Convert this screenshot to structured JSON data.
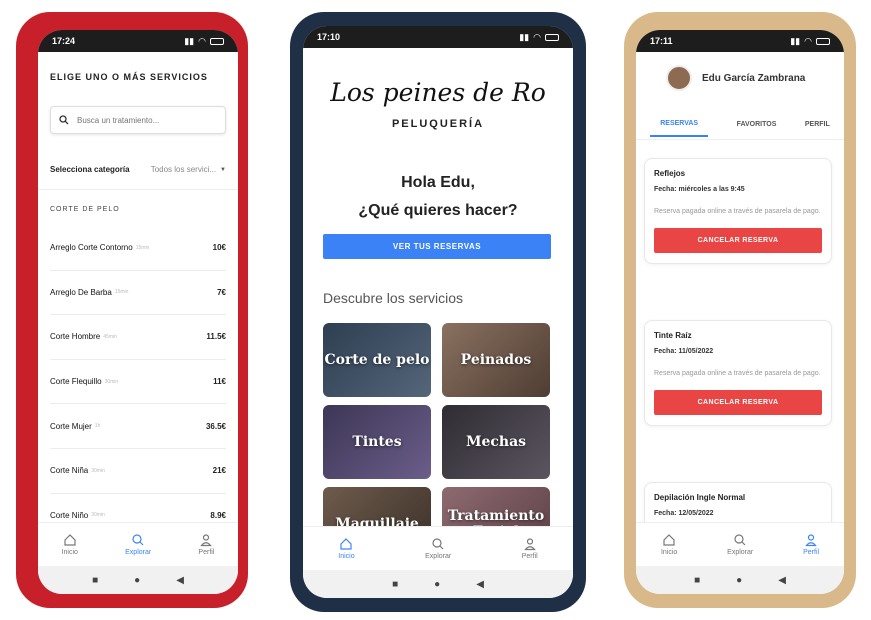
{
  "phone1": {
    "time": "17:24",
    "title": "ELIGE UNO O MÁS SERVICIOS",
    "search_placeholder": "Busca un tratamiento...",
    "category_label": "Selecciona categoría",
    "category_value": "Todos los servici...",
    "group": "CORTE DE PELO",
    "services": [
      {
        "name": "Arreglo Corte Contorno",
        "duration": "15min",
        "price": "10€"
      },
      {
        "name": "Arreglo De Barba",
        "duration": "15min",
        "price": "7€"
      },
      {
        "name": "Corte Hombre",
        "duration": "45min",
        "price": "11.5€"
      },
      {
        "name": "Corte Flequillo",
        "duration": "30min",
        "price": "11€"
      },
      {
        "name": "Corte Mujer",
        "duration": "1h",
        "price": "36.5€"
      },
      {
        "name": "Corte Niña",
        "duration": "30min",
        "price": "21€"
      },
      {
        "name": "Corte Niño",
        "duration": "30min",
        "price": "8.9€"
      }
    ],
    "tabs": [
      "Inicio",
      "Explorar",
      "Perfil"
    ]
  },
  "phone2": {
    "time": "17:10",
    "logo": "Los peines de Ro",
    "logo_sub": "PELUQUERÍA",
    "greet1": "Hola Edu,",
    "greet2": "¿Qué quieres hacer?",
    "button": "VER TUS RESERVAS",
    "discover": "Descubre los servicios",
    "cards": [
      {
        "label": "Corte de pelo",
        "color": "#3a4b5e"
      },
      {
        "label": "Peinados",
        "color": "#6d5a4f"
      },
      {
        "label": "Tintes",
        "color": "#4e4466"
      },
      {
        "label": "Mechas",
        "color": "#3d3a3f"
      },
      {
        "label": "Maquillaje",
        "color": "#5a4a3e"
      },
      {
        "label": "Tratamiento Facial",
        "color": "#7a5a60"
      }
    ],
    "tabs": [
      "Inicio",
      "Explorar",
      "Perfil"
    ]
  },
  "phone3": {
    "time": "17:11",
    "user": "Edu García Zambrana",
    "tabs_top": [
      "RESERVAS",
      "FAVORITOS",
      "PERFIL"
    ],
    "reservations": [
      {
        "title": "Reflejos",
        "date": "Fecha: miércoles a las 9:45",
        "note": "Reserva pagada online a través de pasarela de pago.",
        "button": "CANCELAR RESERVA"
      },
      {
        "title": "Tinte Raíz",
        "date": "Fecha: 11/05/2022",
        "note": "Reserva pagada online a través de pasarela de pago.",
        "button": "CANCELAR RESERVA"
      },
      {
        "title": "Depilación Ingle Normal",
        "date": "Fecha: 12/05/2022"
      }
    ],
    "tabs": [
      "Inicio",
      "Explorar",
      "Perfil"
    ]
  },
  "colors": {
    "accent": "#3b82f6",
    "danger": "#e94545"
  }
}
